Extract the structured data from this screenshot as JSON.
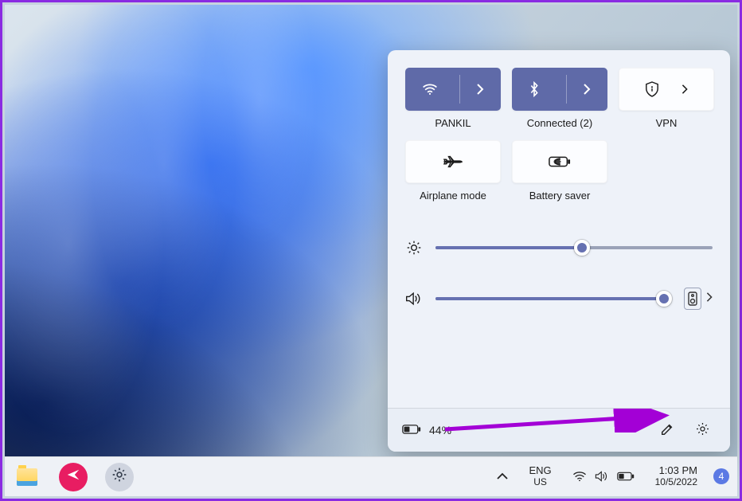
{
  "colors": {
    "accent": "#5f6aa8",
    "annotation": "#a300d6"
  },
  "quick_settings": {
    "tiles": [
      {
        "id": "wifi",
        "label": "PANKIL",
        "active": true,
        "icon": "wifi",
        "expand": true
      },
      {
        "id": "bt",
        "label": "Connected (2)",
        "active": true,
        "icon": "bluetooth",
        "expand": true
      },
      {
        "id": "vpn",
        "label": "VPN",
        "active": false,
        "icon": "shield",
        "expand": true
      },
      {
        "id": "airplane",
        "label": "Airplane mode",
        "active": false,
        "icon": "airplane",
        "expand": false
      },
      {
        "id": "battery",
        "label": "Battery saver",
        "active": false,
        "icon": "batsaver",
        "expand": false
      }
    ],
    "brightness_percent": 53,
    "volume_percent": 97
  },
  "panel_footer": {
    "battery_text": "44%"
  },
  "taskbar": {
    "language": {
      "line1": "ENG",
      "line2": "US"
    },
    "clock": {
      "time": "1:03 PM",
      "date": "10/5/2022"
    },
    "notification_count": "4"
  }
}
